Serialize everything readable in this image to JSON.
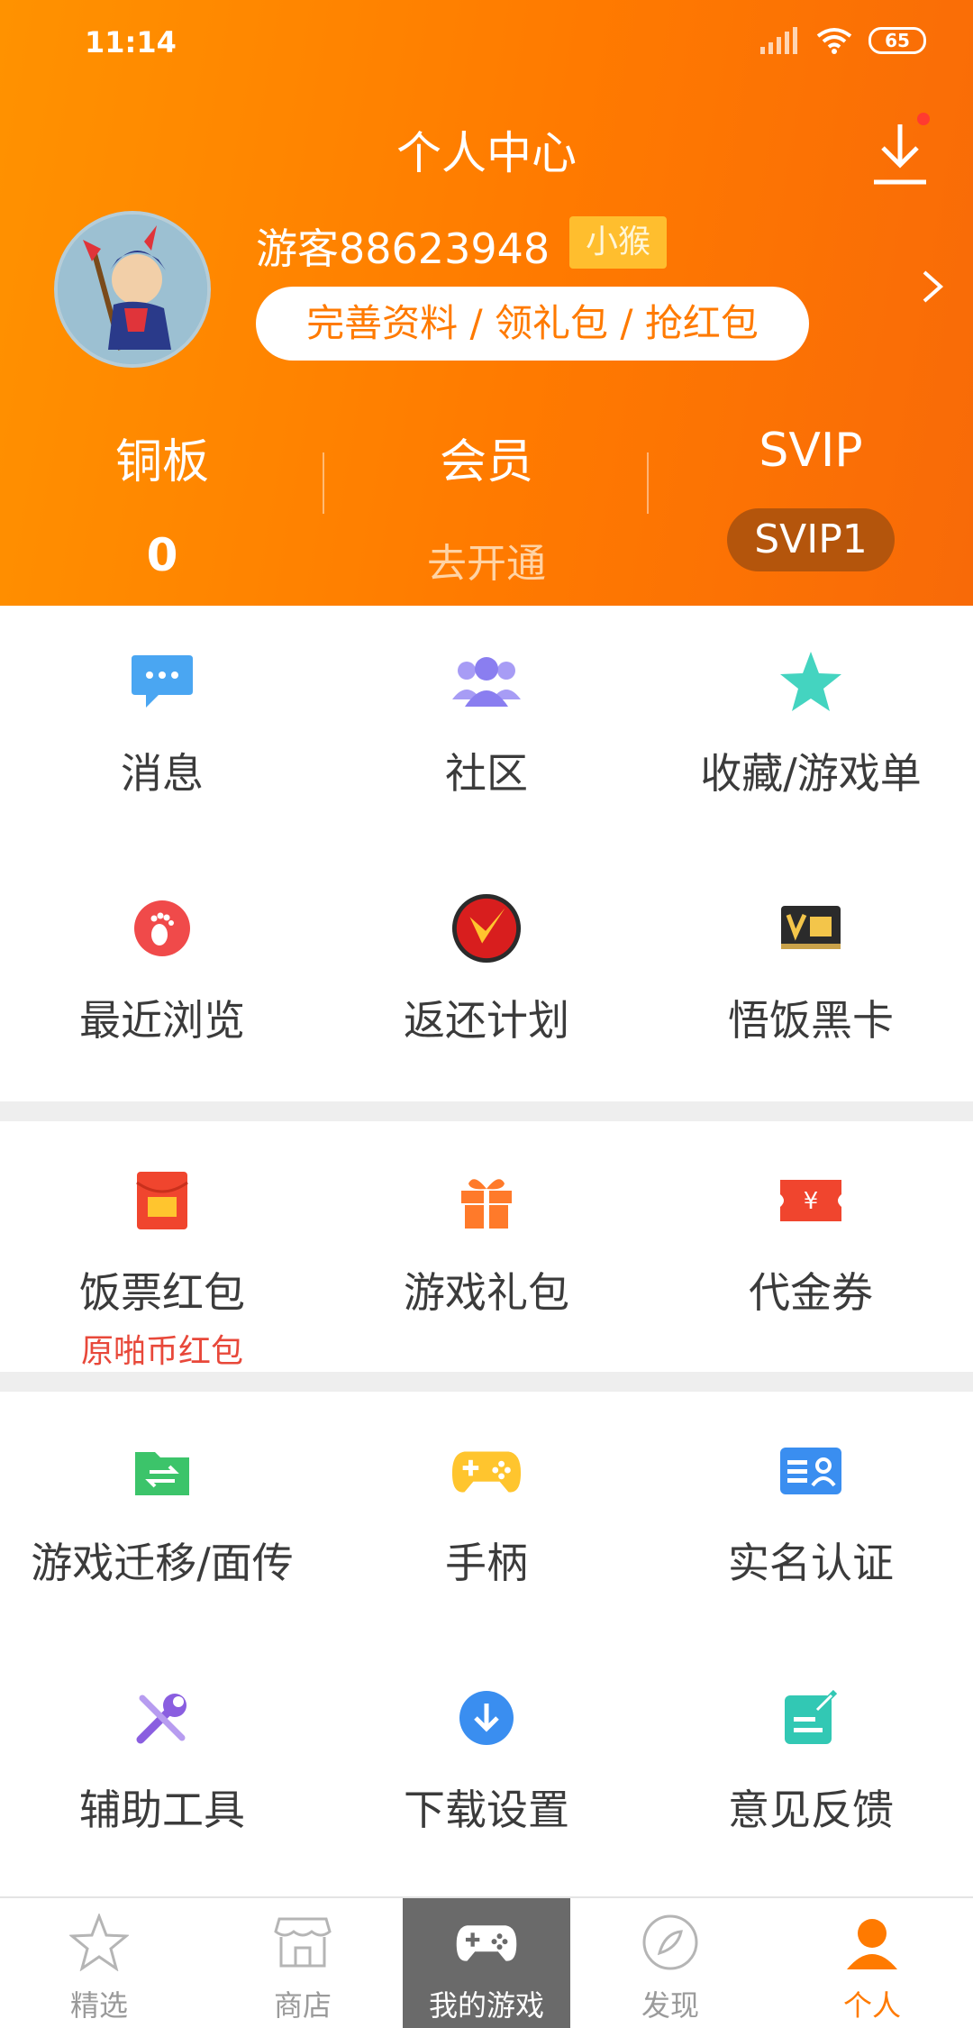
{
  "status_bar": {
    "time": "11:14",
    "battery": "65"
  },
  "header": {
    "title": "个人中心"
  },
  "profile": {
    "username": "游客88623948",
    "badge": "小猴",
    "cta": "完善资料 / 领礼包 / 抢红包"
  },
  "stats": [
    {
      "label": "铜板",
      "value": "0"
    },
    {
      "label": "会员",
      "value": "去开通"
    },
    {
      "label": "SVIP",
      "value": "SVIP1"
    }
  ],
  "sections": [
    {
      "items": [
        {
          "label": "消息",
          "icon": "message-icon",
          "color": "#4aa6f2"
        },
        {
          "label": "社区",
          "icon": "community-icon",
          "color": "#8a7ef0"
        },
        {
          "label": "收藏/游戏单",
          "icon": "star-icon",
          "color": "#44d4c0"
        },
        {
          "label": "最近浏览",
          "icon": "footprint-icon",
          "color": "#f04a4a"
        },
        {
          "label": "返还计划",
          "icon": "rebate-icon",
          "color": "#d81e1e"
        },
        {
          "label": "悟饭黑卡",
          "icon": "black-card-icon",
          "color": "#2b2b2b"
        }
      ]
    },
    {
      "items": [
        {
          "label": "饭票红包",
          "sublabel": "原啪币红包",
          "icon": "red-envelope-icon",
          "color": "#f0452e"
        },
        {
          "label": "游戏礼包",
          "icon": "gift-icon",
          "color": "#ff7a2a"
        },
        {
          "label": "代金券",
          "icon": "coupon-icon",
          "color": "#f0452e"
        }
      ]
    },
    {
      "items": [
        {
          "label": "游戏迁移/面传",
          "icon": "transfer-icon",
          "color": "#3cc46a"
        },
        {
          "label": "手柄",
          "icon": "gamepad-icon",
          "color": "#ffc52e"
        },
        {
          "label": "实名认证",
          "icon": "id-card-icon",
          "color": "#3a8ef0"
        },
        {
          "label": "辅助工具",
          "icon": "tools-icon",
          "color": "#8a5ee0"
        },
        {
          "label": "下载设置",
          "icon": "download-circle-icon",
          "color": "#3a8ef0"
        },
        {
          "label": "意见反馈",
          "icon": "feedback-icon",
          "color": "#32c8b4"
        }
      ]
    }
  ],
  "tabbar": [
    {
      "label": "精选",
      "icon": "star-outline-icon"
    },
    {
      "label": "商店",
      "icon": "shop-icon"
    },
    {
      "label": "我的游戏",
      "icon": "gamepad-tab-icon"
    },
    {
      "label": "发现",
      "icon": "compass-icon"
    },
    {
      "label": "个人",
      "icon": "person-icon"
    }
  ],
  "colors": {
    "accent": "#ff7a00",
    "header_start": "#ff9200",
    "header_end": "#f86a08"
  }
}
